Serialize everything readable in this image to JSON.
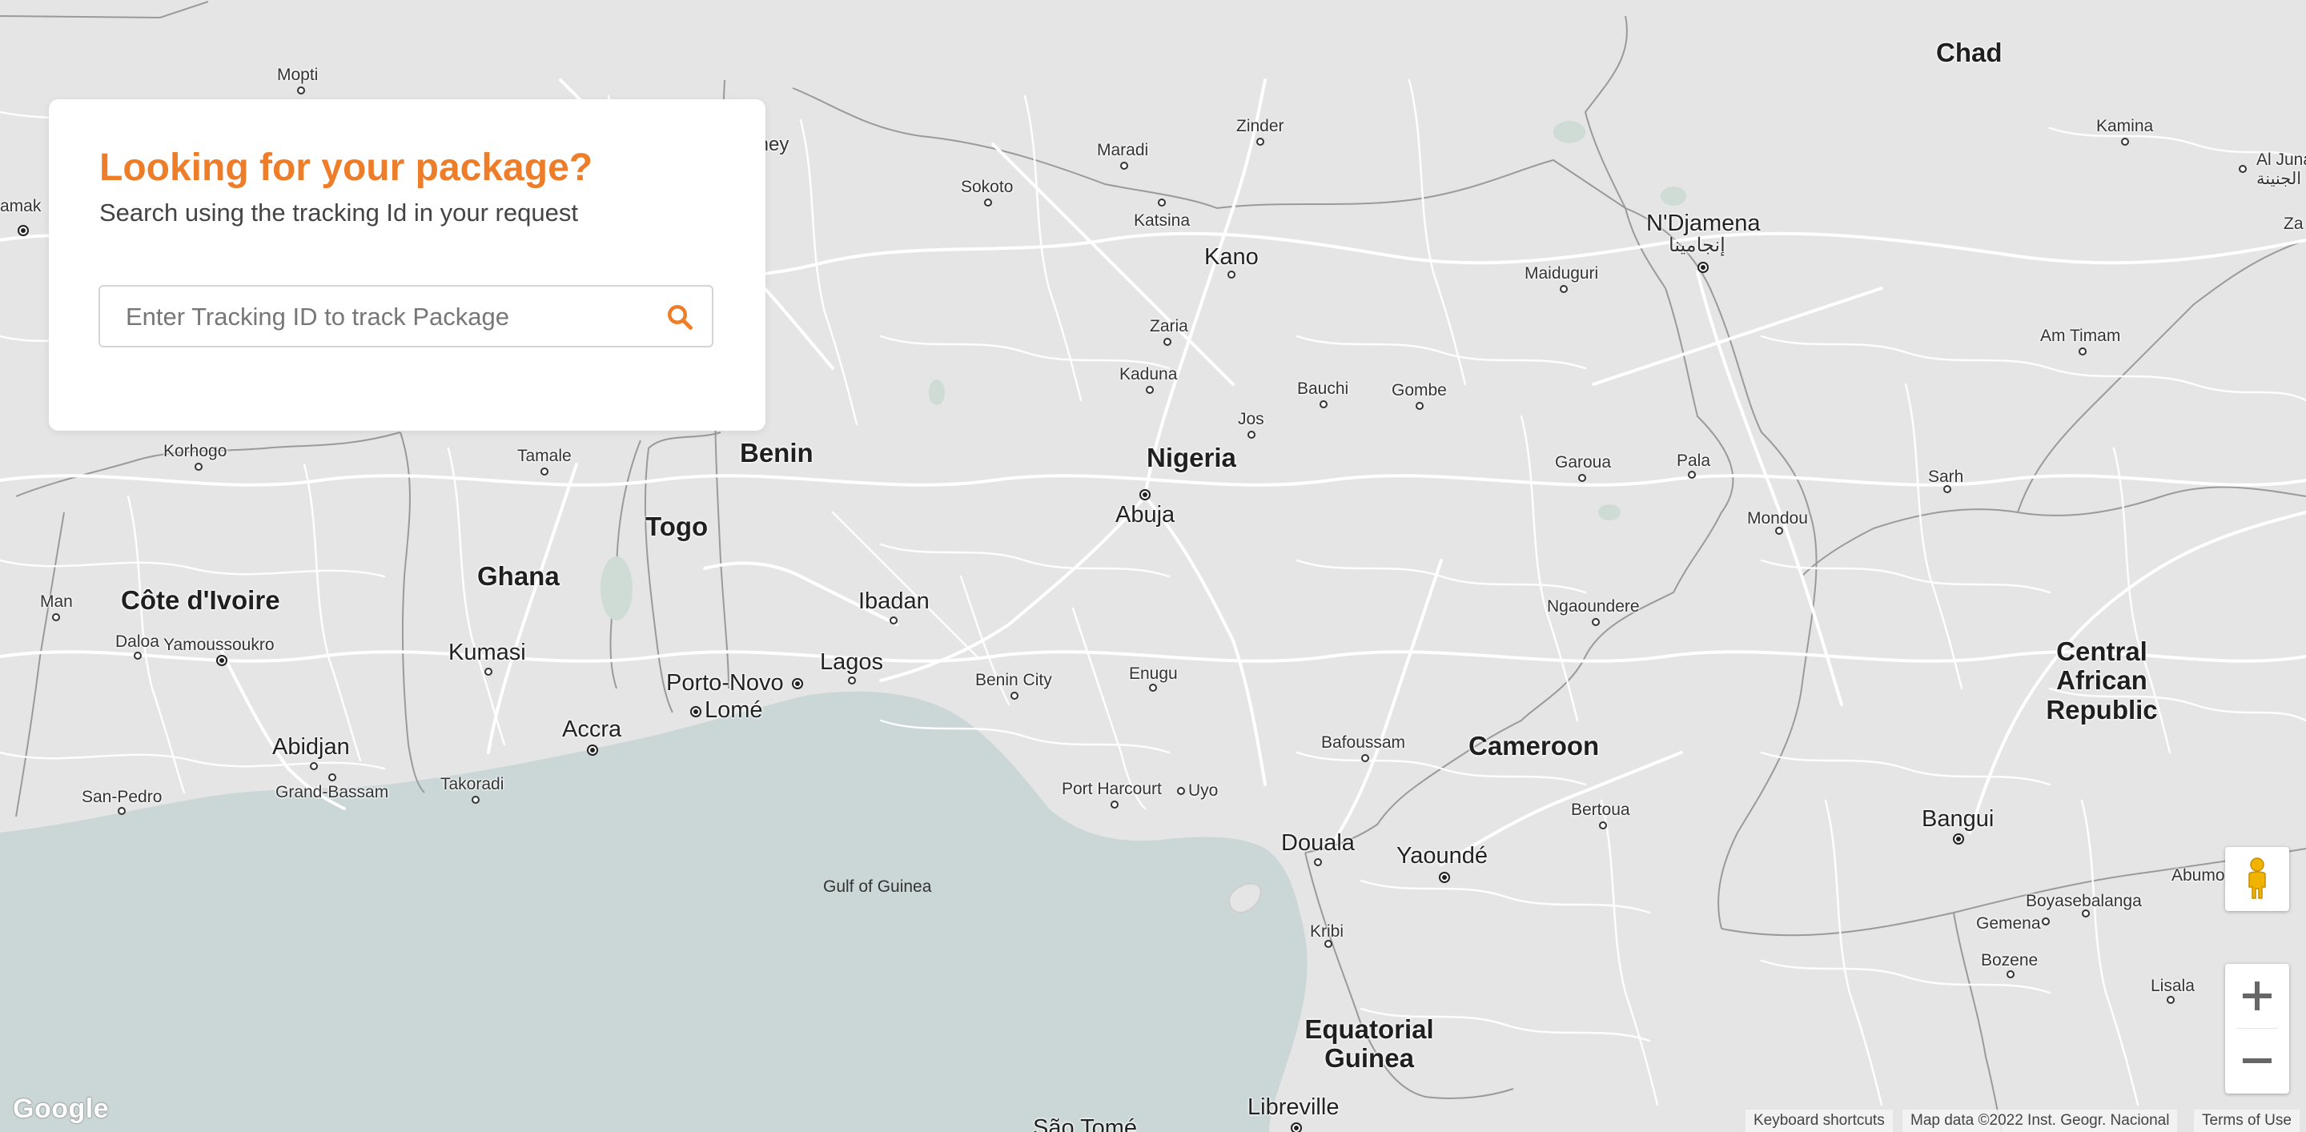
{
  "tracking_card": {
    "title": "Looking for your package?",
    "subtitle": "Search using the tracking Id in your request",
    "search_placeholder": "Enter Tracking ID to track Package",
    "search_value": "",
    "accent_color": "#ee7d29"
  },
  "map": {
    "provider_logo": "Google",
    "attribution": {
      "keyboard_shortcuts": "Keyboard shortcuts",
      "map_data": "Map data ©2022 Inst. Geogr. Nacional",
      "terms": "Terms of Use"
    },
    "controls": {
      "pegman_icon": "street-view-pegman-icon",
      "zoom_in_icon": "plus-icon",
      "zoom_out_icon": "minus-icon"
    },
    "labels": {
      "chad": "Chad",
      "benin": "Benin",
      "togo": "Togo",
      "ghana": "Ghana",
      "cote_divoire": "Côte d'Ivoire",
      "nigeria": "Nigeria",
      "cameroon": "Cameroon",
      "car": "Central African Republic",
      "eq_guinea": "Equatorial Guinea",
      "mopti": "Mopti",
      "zinder": "Zinder",
      "kamina": "Kamina",
      "maradi": "Maradi",
      "sokoto": "Sokoto",
      "katsina": "Katsina",
      "al_juna": "Al Juna",
      "al_juna_ar": "الجنينة",
      "ndjamena": "N'Djamena",
      "ndjamena_ar": "إنجامينا",
      "kano": "Kano",
      "maiduguri": "Maiduguri",
      "zaria": "Zaria",
      "kaduna": "Kaduna",
      "bauchi": "Bauchi",
      "gombe": "Gombe",
      "am_timam": "Am Timam",
      "jos": "Jos",
      "korhogo": "Korhogo",
      "tamale": "Tamale",
      "garoua": "Garoua",
      "pala": "Pala",
      "sarh": "Sarh",
      "abuja": "Abuja",
      "mondou": "Mondou",
      "man": "Man",
      "ibadan": "Ibadan",
      "ngaoundere": "Ngaoundere",
      "daloa": "Daloa",
      "yamoussoukro": "Yamoussoukro",
      "kumasi": "Kumasi",
      "lagos": "Lagos",
      "porto_novo": "Porto-Novo",
      "benin_city": "Benin City",
      "enugu": "Enugu",
      "lome": "Lomé",
      "accra": "Accra",
      "abidjan": "Abidjan",
      "bafoussam": "Bafoussam",
      "takoradi": "Takoradi",
      "grand_bassam": "Grand-Bassam",
      "port_harcourt": "Port Harcourt",
      "uyo": "Uyo",
      "san_pedro": "San-Pedro",
      "bertoua": "Bertoua",
      "bangui": "Bangui",
      "douala": "Douala",
      "yaounde": "Yaoundé",
      "abumo": "Abumo",
      "gulf_of_guinea": "Gulf of Guinea",
      "boyasebalanga": "Boyasebalanga",
      "gemena": "Gemena",
      "kribi": "Kribi",
      "bozene": "Bozene",
      "lisala": "Lisala",
      "libreville": "Libreville",
      "sao_tome": "São Tomé",
      "amak": "amak",
      "mey": "mey",
      "za": "Za"
    }
  }
}
